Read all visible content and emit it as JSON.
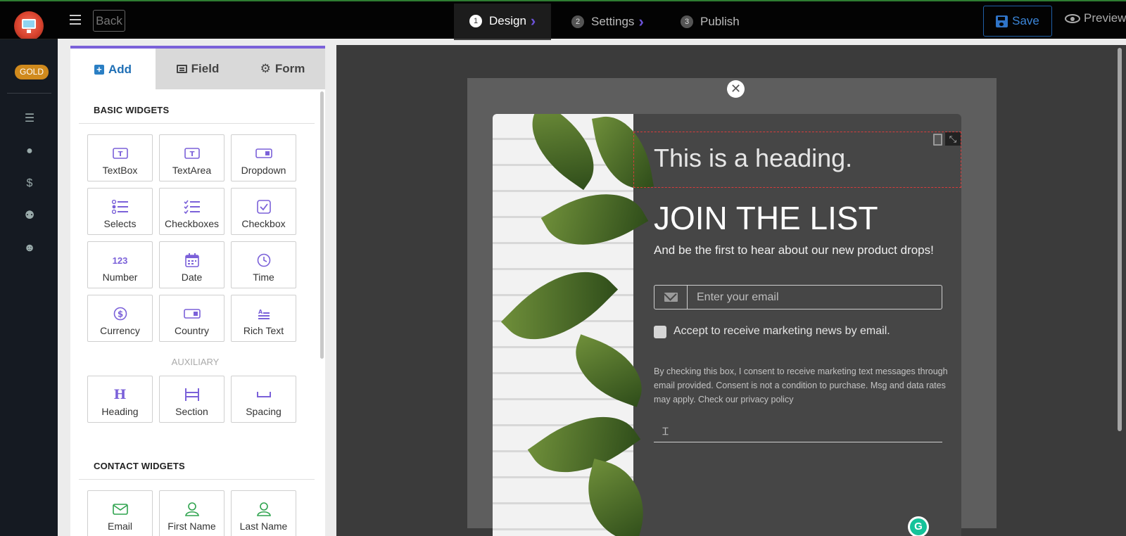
{
  "topbar": {
    "back_label": "Back",
    "steps": [
      {
        "num": "1",
        "label": "Design"
      },
      {
        "num": "2",
        "label": "Settings"
      },
      {
        "num": "3",
        "label": "Publish"
      }
    ],
    "save_label": "Save",
    "preview_label": "Preview"
  },
  "rail": {
    "badge": "GOLD",
    "icons": [
      "list-icon",
      "user-icon",
      "dollar-icon",
      "users-icon",
      "smile-icon"
    ]
  },
  "sidebar": {
    "tabs": [
      {
        "label": "Add"
      },
      {
        "label": "Field"
      },
      {
        "label": "Form"
      }
    ],
    "basic_header": "BASIC WIDGETS",
    "basic_widgets": [
      "TextBox",
      "TextArea",
      "Dropdown",
      "Selects",
      "Checkboxes",
      "Checkbox",
      "Number",
      "Date",
      "Time",
      "Currency",
      "Country",
      "Rich Text"
    ],
    "aux_header": "AUXILIARY",
    "aux_widgets": [
      "Heading",
      "Section",
      "Spacing"
    ],
    "contact_header": "CONTACT WIDGETS",
    "contact_widgets": [
      "Email",
      "First Name",
      "Last Name"
    ],
    "number_icon_text": "123"
  },
  "popup": {
    "heading": "This is a heading.",
    "title": "JOIN THE LIST",
    "subtitle": "And be the first to hear about our new product drops!",
    "email_placeholder": "Enter your email",
    "checkbox_label": "Accept to receive marketing news by email.",
    "consent_text": "By checking this box, I consent to receive marketing text messages through email provided. Consent is not a condition to purchase. Msg and data rates may apply. Check our privacy policy"
  },
  "colors": {
    "accent": "#7b61d9",
    "save_blue": "#1f5fa6",
    "gold": "#d08a1d",
    "contact_green": "#2fa34e"
  }
}
